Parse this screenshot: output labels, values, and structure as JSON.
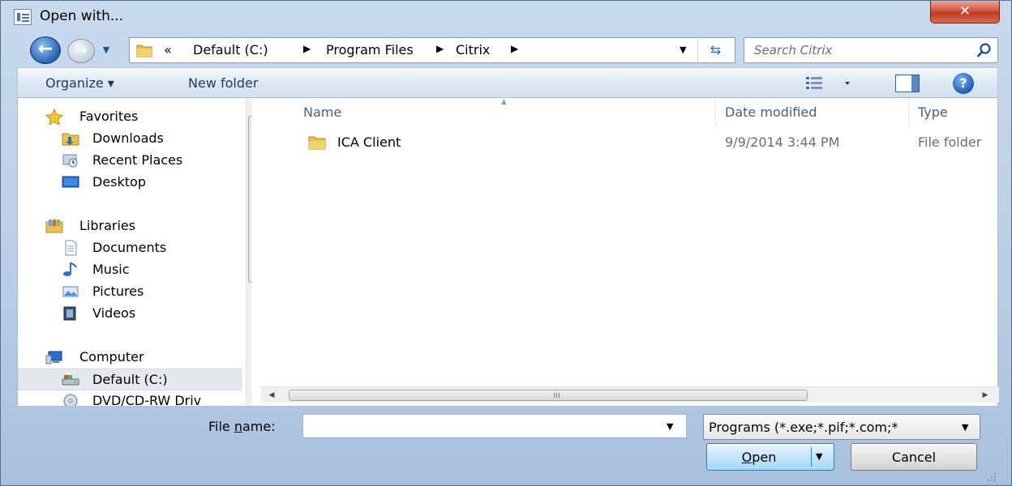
{
  "window": {
    "title": "Open with..."
  },
  "address_bar": {
    "crumbs": [
      {
        "label": "«"
      },
      {
        "label": "Default (C:)"
      },
      {
        "label": "Program Files"
      },
      {
        "label": "Citrix"
      }
    ],
    "separator": "▶",
    "search_placeholder": "Search Citrix"
  },
  "toolbar": {
    "organize": "Organize ▾",
    "new_folder": "New folder"
  },
  "nav_pane": {
    "favorites": {
      "header": "Favorites",
      "items": [
        "Downloads",
        "Recent Places",
        "Desktop"
      ]
    },
    "libraries": {
      "header": "Libraries",
      "items": [
        "Documents",
        "Music",
        "Pictures",
        "Videos"
      ]
    },
    "computer": {
      "header": "Computer",
      "items": [
        "Default (C:)",
        "DVD/CD-RW Driv"
      ]
    },
    "selected": "Default (C:)"
  },
  "file_list": {
    "columns": [
      "Name",
      "Date modified",
      "Type"
    ],
    "rows": [
      {
        "name": "ICA Client",
        "date": "9/9/2014 3:44 PM",
        "type": "File folder"
      }
    ]
  },
  "bottom": {
    "file_name_label_pre": "File ",
    "file_name_label_accel": "n",
    "file_name_label_post": "ame:",
    "file_name_value": "",
    "filter": "Programs (*.exe;*.pif;*.com;*",
    "open_accel": "O",
    "open_rest": "pen",
    "cancel": "Cancel"
  },
  "colors": {
    "accent": "#2561b3",
    "close": "#c23a22",
    "open_button": "#c4e5f8"
  }
}
